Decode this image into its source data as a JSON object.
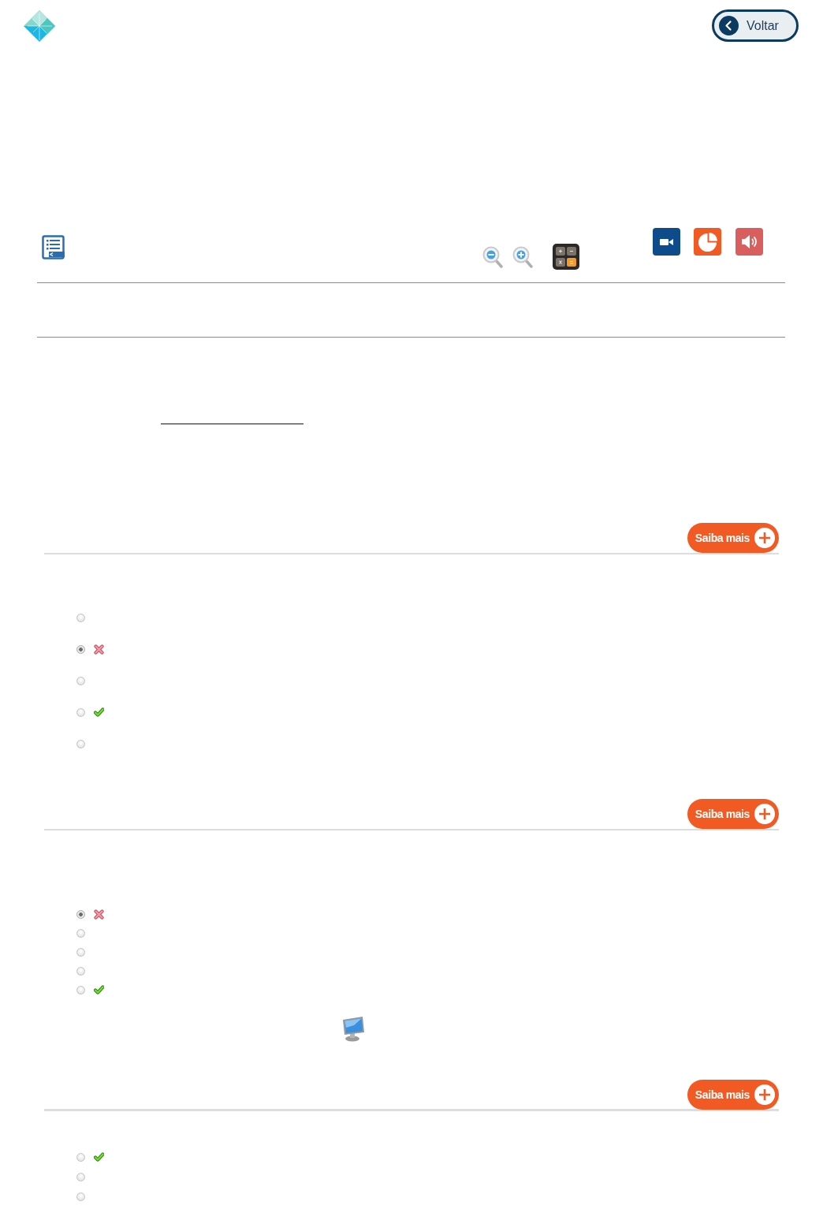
{
  "header": {
    "back_button": {
      "label": "Voltar"
    }
  },
  "questions": [
    {
      "more_button": {
        "label": "Saiba mais"
      },
      "media_icon": false,
      "options": [
        {
          "selected": false,
          "kind": "plain"
        },
        {
          "selected": true,
          "kind": "wrong"
        },
        {
          "selected": false,
          "kind": "plain"
        },
        {
          "selected": false,
          "kind": "correct"
        },
        {
          "selected": false,
          "kind": "plain"
        }
      ]
    },
    {
      "more_button": {
        "label": "Saiba mais"
      },
      "media_icon": true,
      "options": [
        {
          "selected": true,
          "kind": "wrong"
        },
        {
          "selected": false,
          "kind": "plain"
        },
        {
          "selected": false,
          "kind": "plain"
        },
        {
          "selected": false,
          "kind": "plain"
        },
        {
          "selected": false,
          "kind": "correct"
        }
      ]
    },
    {
      "more_button": {
        "label": "Saiba mais"
      },
      "media_icon": false,
      "options": [
        {
          "selected": false,
          "kind": "correct"
        },
        {
          "selected": false,
          "kind": "plain"
        },
        {
          "selected": false,
          "kind": "plain"
        }
      ]
    }
  ]
}
